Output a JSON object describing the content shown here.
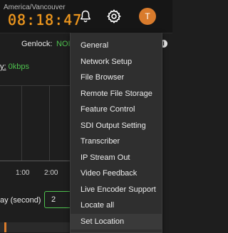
{
  "header": {
    "timezone": "America/Vancouver",
    "clock": "08:18:47",
    "avatar_initial": "T",
    "avatar_color": "#d97b2c",
    "clock_color": "#f39a1e"
  },
  "status": {
    "genlock_label": "Genlock:",
    "genlock_value": "NOI",
    "info_icon": "i"
  },
  "bitrate": {
    "label_tail": "y:",
    "value": "0kbps"
  },
  "chart": {
    "ticks": [
      "1:00",
      "2:00"
    ]
  },
  "delay": {
    "label": "ay (second)",
    "value": "2"
  },
  "settings_menu": {
    "items": [
      "General",
      "Network Setup",
      "File Browser",
      "Remote File Storage",
      "Feature Control",
      "SDI Output Setting",
      "Transcriber",
      "IP Stream Out",
      "Video Feedback",
      "Live Encoder Support",
      "Locate all",
      "Set Location"
    ],
    "hovered": "Set Location"
  },
  "colors": {
    "accent_green": "#4ec24e",
    "menu_bg": "#2f2f2f"
  }
}
